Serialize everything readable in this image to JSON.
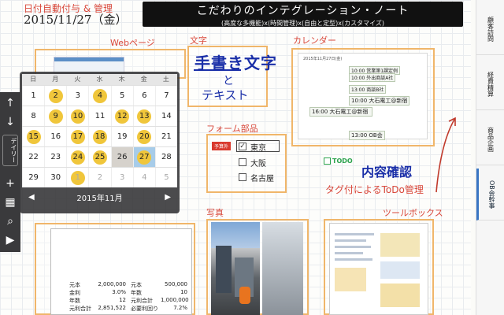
{
  "header": {
    "date_caption": "日付自動付与 & 管理",
    "date": "2015/11/27（金）",
    "title": "こだわりのインテグレーション・ノート",
    "subtitle": "(高度な多機能)x(時間管理)x(自由と定型)x(カスタマイズ)"
  },
  "sections": {
    "web": "Webページ",
    "text": "文字",
    "calendar": "カレンダー",
    "form": "フォーム部品",
    "photo": "写真",
    "toolbox": "ツールボックス"
  },
  "text_note": {
    "handwriting": "手書き文字",
    "to": "と",
    "text": "テキスト"
  },
  "calendar_thumb": {
    "head": "2015年11月27日(金)",
    "events": [
      "10:00 営業第1課定例",
      "10:00 外出商談A社",
      "13:00 商談B社",
      "10:00 大石電工@新宿",
      "16:00 大石電工@新宿",
      "13:00 OB会"
    ]
  },
  "form": {
    "tag": "予算外",
    "options": [
      {
        "label": "東京",
        "checked": true
      },
      {
        "label": "大阪",
        "checked": false
      },
      {
        "label": "名古屋",
        "checked": false
      }
    ]
  },
  "todo": {
    "tag": "TODO",
    "handwriting": "内容確認",
    "caption": "タグ付によるToDo管理"
  },
  "sheet": {
    "rows": [
      [
        "元本",
        "2,000,000",
        "元本",
        "500,000"
      ],
      [
        "金利",
        "3.0%",
        "年数",
        "10"
      ],
      [
        "年数",
        "12",
        "元利合計",
        "1,000,000"
      ],
      [
        "元利合計",
        "2,851,522",
        "必要利回り",
        "7.2%"
      ]
    ]
  },
  "popup_calendar": {
    "weekdays": [
      "日",
      "月",
      "火",
      "水",
      "木",
      "金",
      "土"
    ],
    "weeks": [
      [
        {
          "d": "1",
          "m": false,
          "p": false
        },
        {
          "d": "2",
          "m": true,
          "p": false
        },
        {
          "d": "3",
          "m": false,
          "p": false
        },
        {
          "d": "4",
          "m": true,
          "p": false
        },
        {
          "d": "5",
          "m": false,
          "p": false
        },
        {
          "d": "6",
          "m": false,
          "p": false
        },
        {
          "d": "7",
          "m": false,
          "p": false
        }
      ],
      [
        {
          "d": "8",
          "m": false,
          "p": false
        },
        {
          "d": "9",
          "m": true,
          "p": false
        },
        {
          "d": "10",
          "m": true,
          "p": false
        },
        {
          "d": "11",
          "m": false,
          "p": false
        },
        {
          "d": "12",
          "m": true,
          "p": false
        },
        {
          "d": "13",
          "m": true,
          "p": false
        },
        {
          "d": "14",
          "m": false,
          "p": false
        }
      ],
      [
        {
          "d": "15",
          "m": true,
          "p": false
        },
        {
          "d": "16",
          "m": false,
          "p": false
        },
        {
          "d": "17",
          "m": true,
          "p": false
        },
        {
          "d": "18",
          "m": true,
          "p": false
        },
        {
          "d": "19",
          "m": false,
          "p": false
        },
        {
          "d": "20",
          "m": true,
          "p": false
        },
        {
          "d": "21",
          "m": false,
          "p": false
        }
      ],
      [
        {
          "d": "22",
          "m": false,
          "p": false
        },
        {
          "d": "23",
          "m": false,
          "p": false
        },
        {
          "d": "24",
          "m": true,
          "p": false
        },
        {
          "d": "25",
          "m": true,
          "p": false
        },
        {
          "d": "26",
          "m": false,
          "p": false,
          "g": true
        },
        {
          "d": "27",
          "m": true,
          "p": false,
          "t": true
        },
        {
          "d": "28",
          "m": false,
          "p": false
        }
      ],
      [
        {
          "d": "29",
          "m": false,
          "p": false
        },
        {
          "d": "30",
          "m": false,
          "p": false
        },
        {
          "d": "1",
          "m": true,
          "p": true
        },
        {
          "d": "2",
          "m": false,
          "p": true
        },
        {
          "d": "3",
          "m": false,
          "p": true
        },
        {
          "d": "4",
          "m": false,
          "p": true
        },
        {
          "d": "5",
          "m": false,
          "p": true
        }
      ]
    ],
    "month": "2015年11月",
    "prev": "◀",
    "next": "▶"
  },
  "toolbar": {
    "up": "↑",
    "down": "↓",
    "diary": "デイリー",
    "add": "+",
    "calendar_icon": "▦",
    "search_icon": "⌕",
    "more": "▶"
  },
  "tabs": [
    "顧客訪問",
    "経費精算",
    "商品企画",
    "OB会幹事"
  ]
}
